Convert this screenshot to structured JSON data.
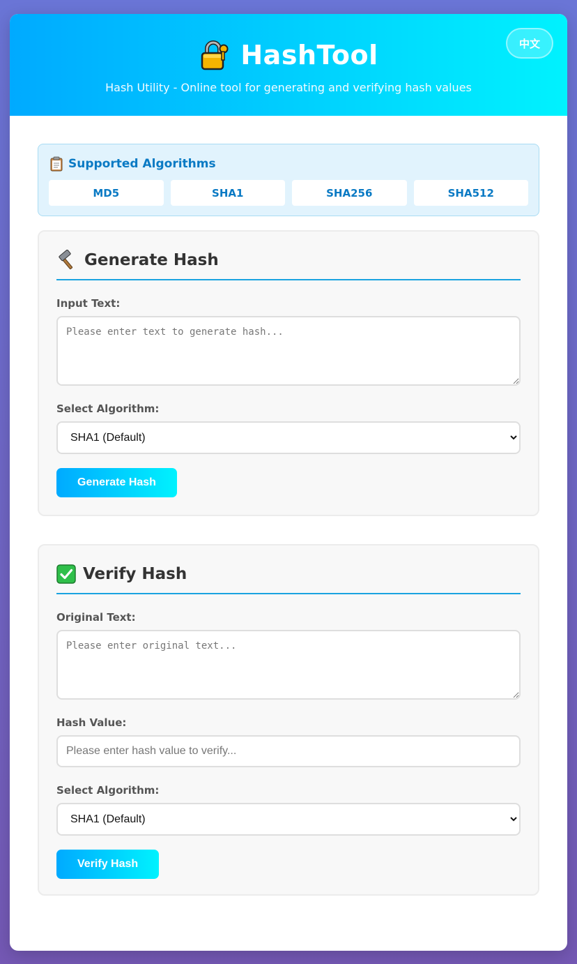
{
  "header": {
    "icon": "lock-with-key-icon",
    "title": "HashTool",
    "subtitle": "Hash Utility - Online tool for generating and verifying hash values",
    "lang_button": "中文"
  },
  "algorithms": {
    "icon": "clipboard-icon",
    "title": "Supported Algorithms",
    "items": [
      "MD5",
      "SHA1",
      "SHA256",
      "SHA512"
    ]
  },
  "generate": {
    "icon": "hammer-icon",
    "title": "Generate Hash",
    "input_label": "Input Text:",
    "input_placeholder": "Please enter text to generate hash...",
    "algo_label": "Select Algorithm:",
    "algo_selected": "SHA1 (Default)",
    "button": "Generate Hash"
  },
  "verify": {
    "icon": "check-mark-icon",
    "title": "Verify Hash",
    "original_label": "Original Text:",
    "original_placeholder": "Please enter original text...",
    "hash_label": "Hash Value:",
    "hash_placeholder": "Please enter hash value to verify...",
    "algo_label": "Select Algorithm:",
    "algo_selected": "SHA1 (Default)",
    "button": "Verify Hash"
  },
  "colors": {
    "accent_start": "#00aaff",
    "accent_end": "#00f2fe",
    "link_blue": "#0a7ac4",
    "page_bg_start": "#6a75d6",
    "page_bg_end": "#7458b4"
  }
}
